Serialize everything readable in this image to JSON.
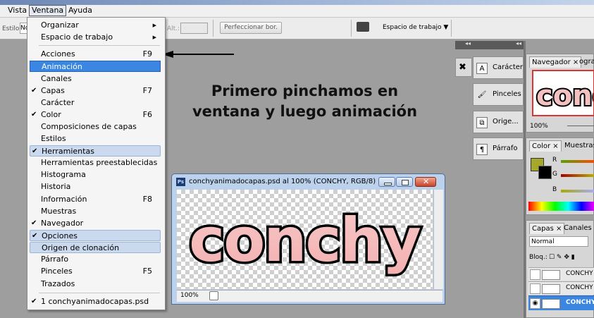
{
  "menubar": {
    "vista": "Vista",
    "ventana": "Ventana",
    "ayuda": "Ayuda"
  },
  "options": {
    "estilo_label": "Estilo:",
    "estilo_value": "No",
    "alt_label": "Alt.:",
    "perfeccionar": "Perfeccionar bor.",
    "workspace": "Espacio de trabajo ▼"
  },
  "dropdown": {
    "organizar": "Organizar",
    "espacio": "Espacio de trabajo",
    "acciones": "Acciones",
    "acciones_sc": "F9",
    "animacion": "Animación",
    "canales": "Canales",
    "capas": "Capas",
    "capas_sc": "F7",
    "caracter": "Carácter",
    "color": "Color",
    "color_sc": "F6",
    "composiciones": "Composiciones de capas",
    "estilos": "Estilos",
    "herramientas": "Herramientas",
    "herr_pre": "Herramientas preestablecidas",
    "histograma": "Histograma",
    "historia": "Historia",
    "informacion": "Información",
    "informacion_sc": "F8",
    "muestras": "Muestras",
    "navegador": "Navegador",
    "opciones": "Opciones",
    "origen": "Origen de clonación",
    "parrafo": "Párrafo",
    "pinceles": "Pinceles",
    "pinceles_sc": "F5",
    "trazados": "Trazados",
    "archivo": "1 conchyanimadocapas.psd",
    "check": "✔"
  },
  "caption": {
    "line1": "Primero pinchamos en",
    "line2": "ventana y luego animación"
  },
  "document": {
    "title": "conchyanimadocapas.psd al 100% (CONCHY, RGB/8)",
    "art_text": "conchy",
    "zoom": "100%",
    "ps": "Ps"
  },
  "panels": {
    "caracter": "Carácter",
    "pinceles": "Pinceles",
    "origen": "Orige...",
    "parrafo": "Párrafo",
    "navegador_tab": "Navegador ×",
    "navegador_tab2": "ograr",
    "nav_zoom": "100%",
    "nav_thumb": "conc",
    "color_tab": "Color ×",
    "muestras_tab": "Muestras",
    "r": "R",
    "g": "G",
    "b": "B",
    "capas_tab": "Capas ×",
    "canales_tab": "Canales",
    "blend": "Normal",
    "bloq": "Bloq.:",
    "layer1": "CONCHY",
    "layer2": "CONCHY",
    "layer3": "CONCHY",
    "collapse": "◂◂"
  }
}
